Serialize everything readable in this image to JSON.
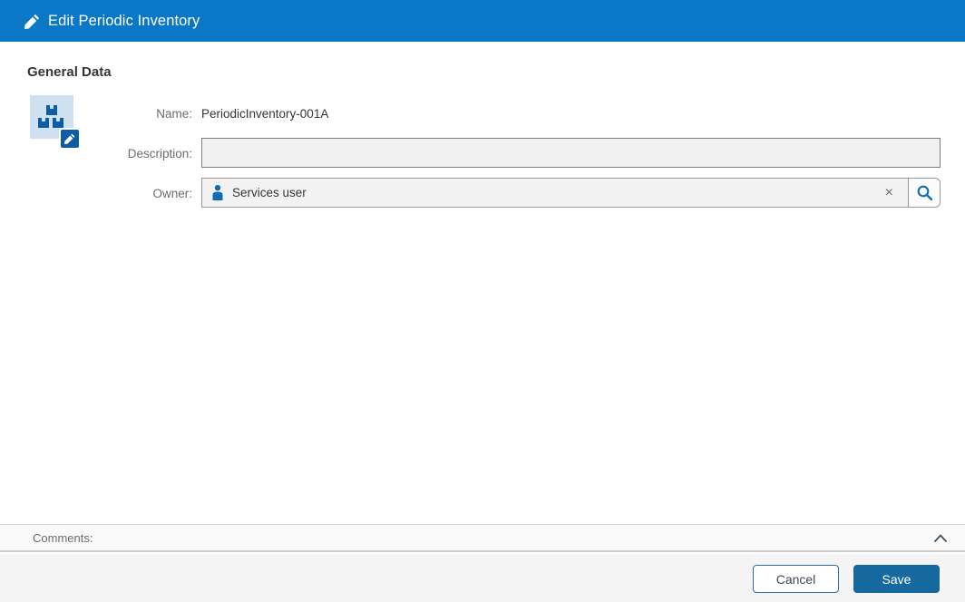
{
  "header": {
    "title": "Edit Periodic Inventory",
    "icon": "pencil-icon"
  },
  "content": {
    "section_title": "General Data",
    "entity_icon": "inventory-boxes-icon",
    "entity_icon_badge": "edit-pencil-icon"
  },
  "form": {
    "name_label": "Name:",
    "name_value": "PeriodicInventory-001A",
    "description_label": "Description:",
    "description_value": "",
    "description_placeholder": "",
    "owner_label": "Owner:",
    "owner_value": "Services user",
    "owner_icon": "person-icon",
    "owner_clear_icon": "×",
    "owner_search_icon": "magnifier-icon"
  },
  "comments": {
    "label": "Comments:",
    "collapse_icon": "chevron-up-icon"
  },
  "footer": {
    "cancel_label": "Cancel",
    "save_label": "Save"
  },
  "colors": {
    "header_bg": "#0a78c6",
    "icon_bg": "#cfe0f0",
    "icon_fg": "#0d5ca8",
    "accent_blue": "#0f6cb4",
    "save_bg": "#16699e",
    "label_gray": "#6a6d70",
    "value_dark": "#32363a",
    "footer_bg": "#f4f4f4"
  }
}
